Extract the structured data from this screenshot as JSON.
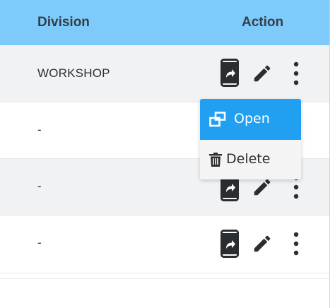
{
  "table": {
    "headers": {
      "division": "Division",
      "action": "Action"
    },
    "rows": [
      {
        "division": "WORKSHOP"
      },
      {
        "division": "-"
      },
      {
        "division": "-"
      },
      {
        "division": "-"
      }
    ]
  },
  "row_menu": {
    "items": [
      {
        "label": "Open",
        "icon": "open-in-new-window-icon"
      },
      {
        "label": "Delete",
        "icon": "trash-icon"
      }
    ]
  },
  "action_icons": [
    "phone-forward-icon",
    "pencil-icon",
    "more-vertical-icon"
  ],
  "colors": {
    "header_bg": "#7ecbfb",
    "menu_highlight": "#21a0f2",
    "row_shade": "#f0f2f4",
    "text": "#2b3034",
    "icon": "#2a2e31"
  }
}
